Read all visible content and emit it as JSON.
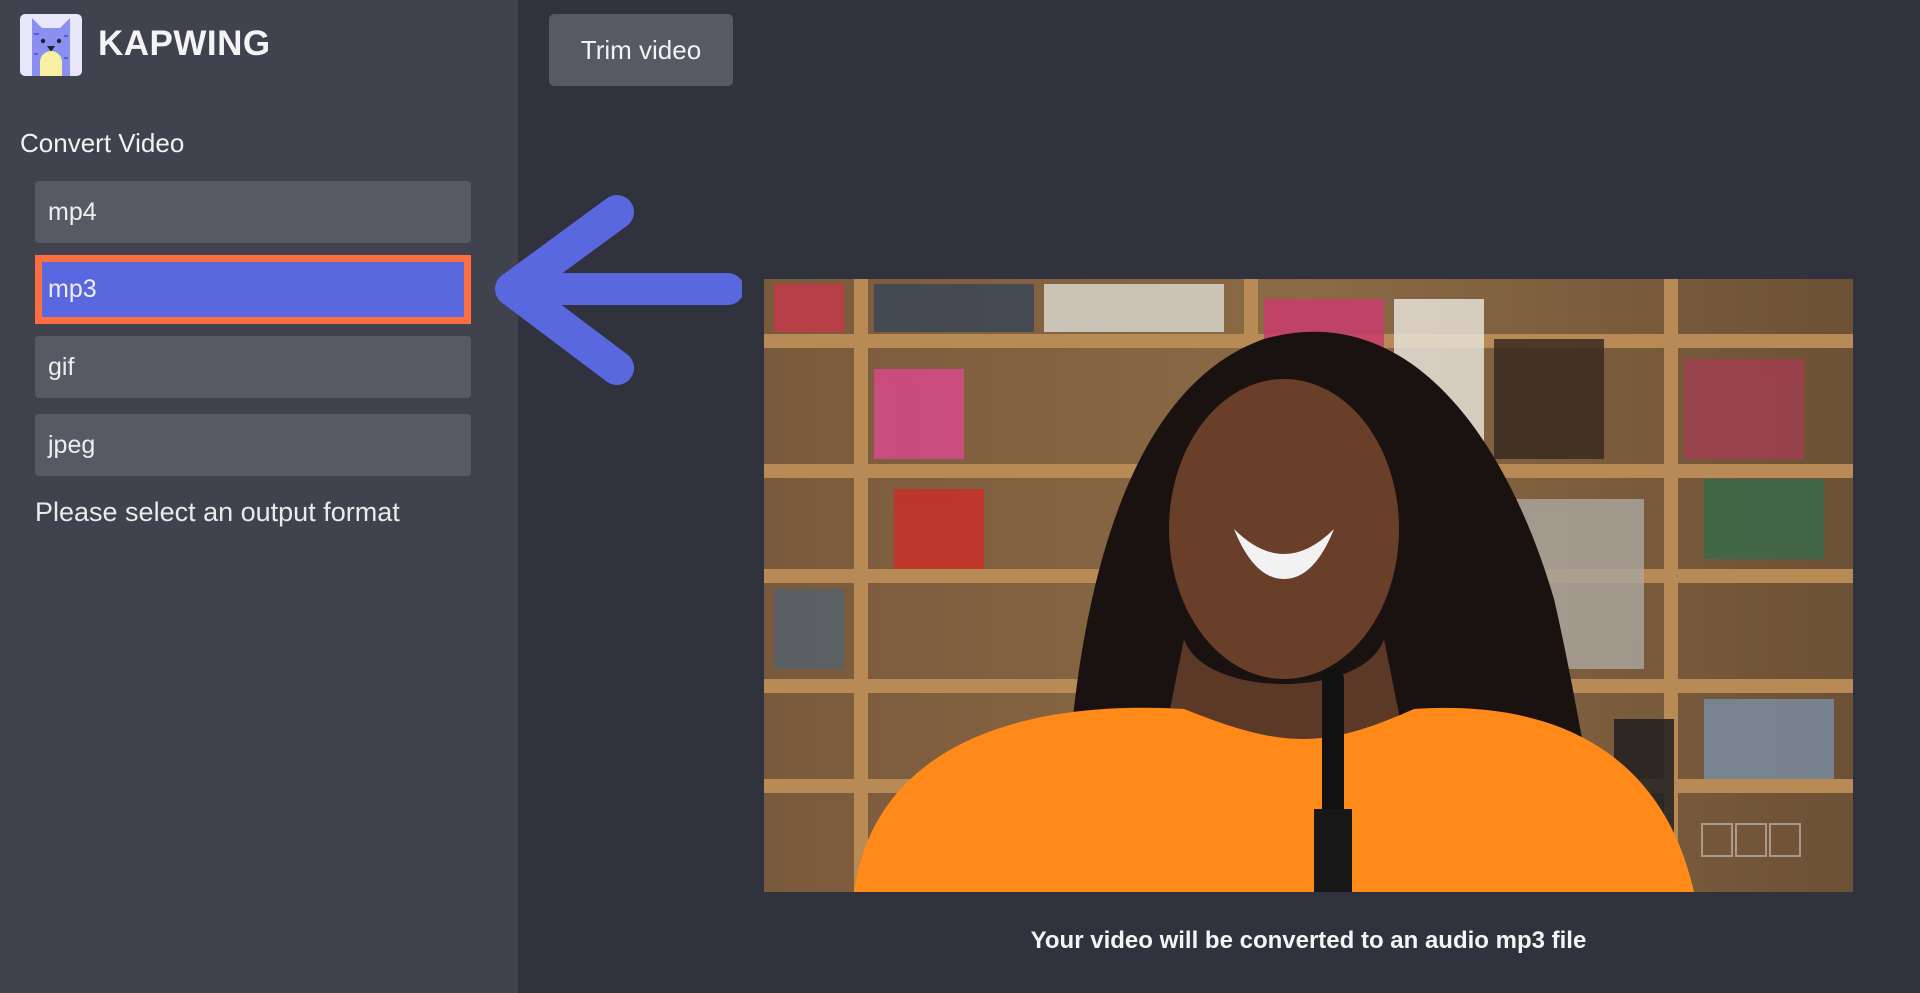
{
  "brand": {
    "name": "KAPWING",
    "logo_icon": "cat-logo-icon"
  },
  "sidebar": {
    "section_title": "Convert Video",
    "formats": [
      {
        "label": "mp4",
        "selected": false
      },
      {
        "label": "mp3",
        "selected": true
      },
      {
        "label": "gif",
        "selected": false
      },
      {
        "label": "jpeg",
        "selected": false
      }
    ],
    "hint": "Please select an output format"
  },
  "toolbar": {
    "trim_label": "Trim video"
  },
  "annotation": {
    "arrow_icon": "arrow-left-icon",
    "arrow_color": "#5a68e0",
    "highlight_color": "#fa6e42"
  },
  "video": {
    "watermark": "npr"
  },
  "caption": "Your video will be converted to an audio mp3 file",
  "colors": {
    "sidebar_bg": "#40434d",
    "main_bg": "#30333d",
    "button_bg": "#575a64",
    "selected_bg": "#5a68e0"
  }
}
